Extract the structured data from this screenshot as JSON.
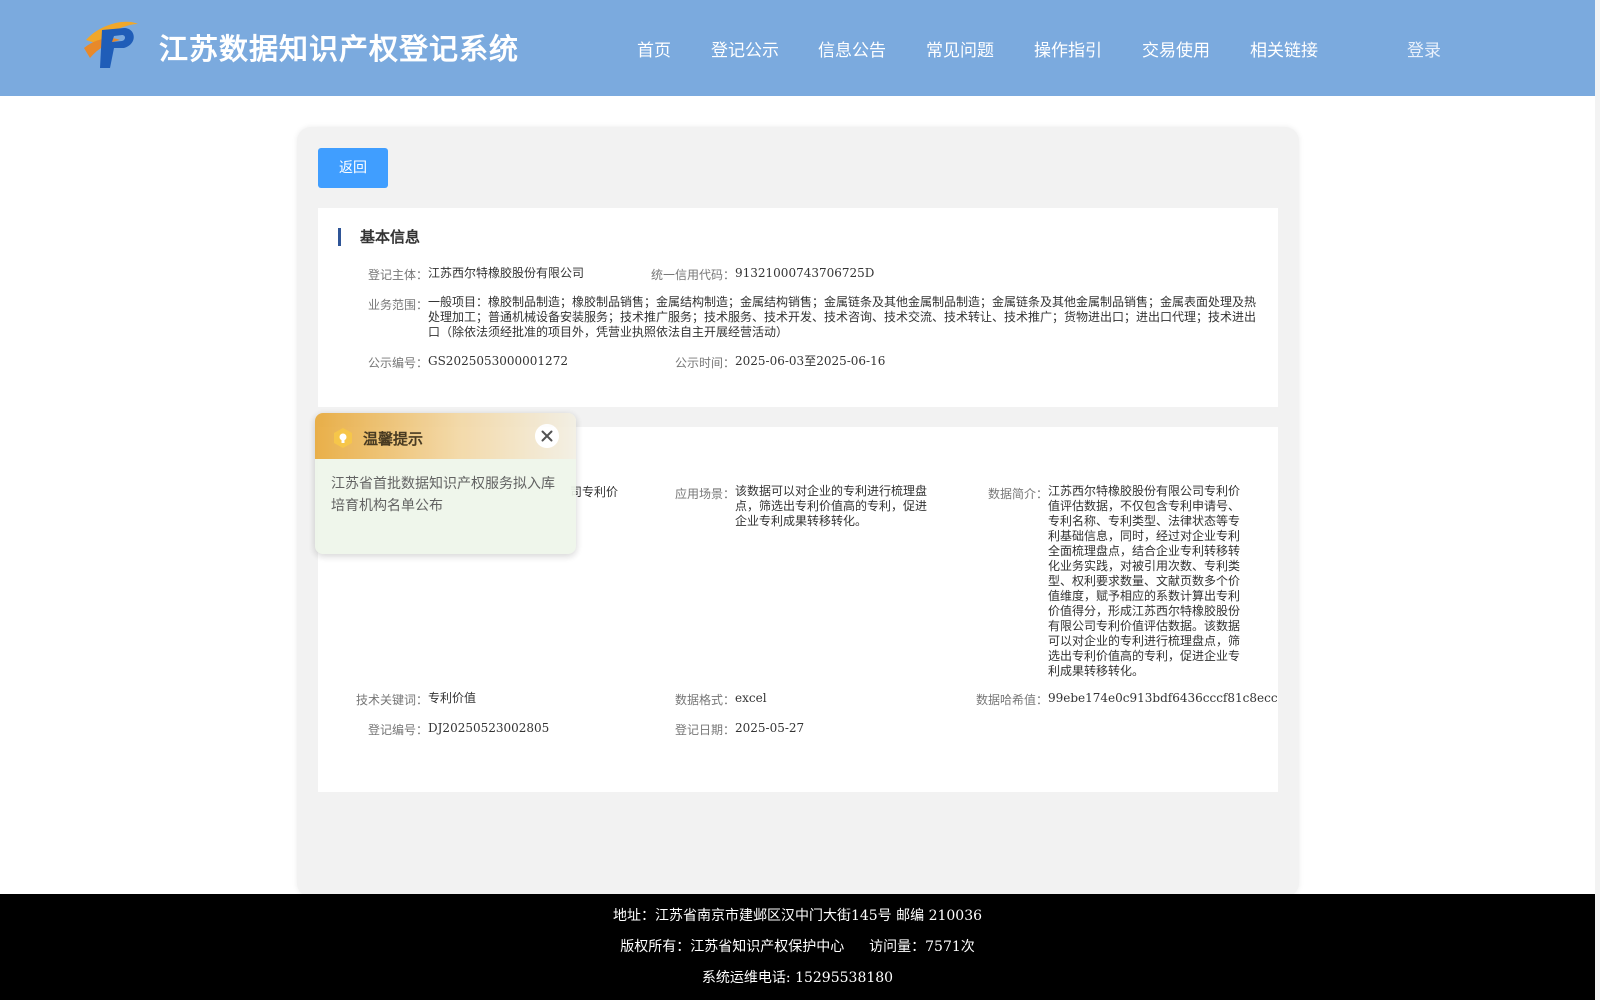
{
  "header": {
    "site_title": "江苏数据知识产权登记系统",
    "nav": [
      "首页",
      "登记公示",
      "信息公告",
      "常见问题",
      "操作指引",
      "交易使用",
      "相关链接"
    ],
    "login": "登录"
  },
  "back_label": "返回",
  "basic_info": {
    "title": "基本信息",
    "subject_label": "登记主体：",
    "subject": "江苏西尔特橡胶股份有限公司",
    "credit_code_label": "统一信用代码：",
    "credit_code": "91321000743706725D",
    "scope_label": "业务范围：",
    "scope": "一般项目：橡胶制品制造；橡胶制品销售；金属结构制造；金属结构销售；金属链条及其他金属制品制造；金属链条及其他金属制品销售；金属表面处理及热处理加工；普通机械设备安装服务；技术推广服务；技术服务、技术开发、技术咨询、技术交流、技术转让、技术推广；货物进出口；进出口代理；技术进出口（除依法须经批准的项目外，凭营业执照依法自主开展经营活动）",
    "notice_no_label": "公示编号：",
    "notice_no": "GS2025053000001272",
    "notice_time_label": "公示时间：",
    "notice_time": "2025-06-03至2025-06-16"
  },
  "data_info": {
    "name_fragment": "司专利价",
    "scene_label": "应用场景：",
    "scene": "该数据可以对企业的专利进行梳理盘点，筛选出专利价值高的专利，促进企业专利成果转移转化。",
    "intro_label": "数据简介：",
    "intro": "江苏西尔特橡胶股份有限公司专利价值评估数据，不仅包含专利申请号、专利名称、专利类型、法律状态等专利基础信息，同时，经过对企业专利全面梳理盘点，结合企业专利转移转化业务实践，对被引用次数、专利类型、权利要求数量、文献页数多个价值维度，赋予相应的系数计算出专利价值得分，形成江苏西尔特橡胶股份有限公司专利价值评估数据。该数据可以对企业的专利进行梳理盘点，筛选出专利价值高的专利，促进企业专利成果转移转化。",
    "keyword_label": "技术关键词：",
    "keyword": "专利价值",
    "format_label": "数据格式：",
    "format": "excel",
    "hash_label": "数据哈希值：",
    "hash": "99ebe174e0c913bdf6436cccf81c8ecc",
    "reg_no_label": "登记编号：",
    "reg_no": "DJ20250523002805",
    "reg_date_label": "登记日期：",
    "reg_date": "2025-05-27"
  },
  "popup": {
    "title": "温馨提示",
    "message": "江苏省首批数据知识产权服务拟入库培育机构名单公布"
  },
  "footer": {
    "address": "地址：江苏省南京市建邺区汉中门大街145号 邮编 210036",
    "copyright": "版权所有：江苏省知识产权保护中心",
    "visits": "访问量：7571次",
    "phone": "系统运维电话: 15295538180"
  },
  "colors": {
    "header_bg": "#7baade",
    "accent": "#409eff",
    "footer_bg": "#000000"
  }
}
